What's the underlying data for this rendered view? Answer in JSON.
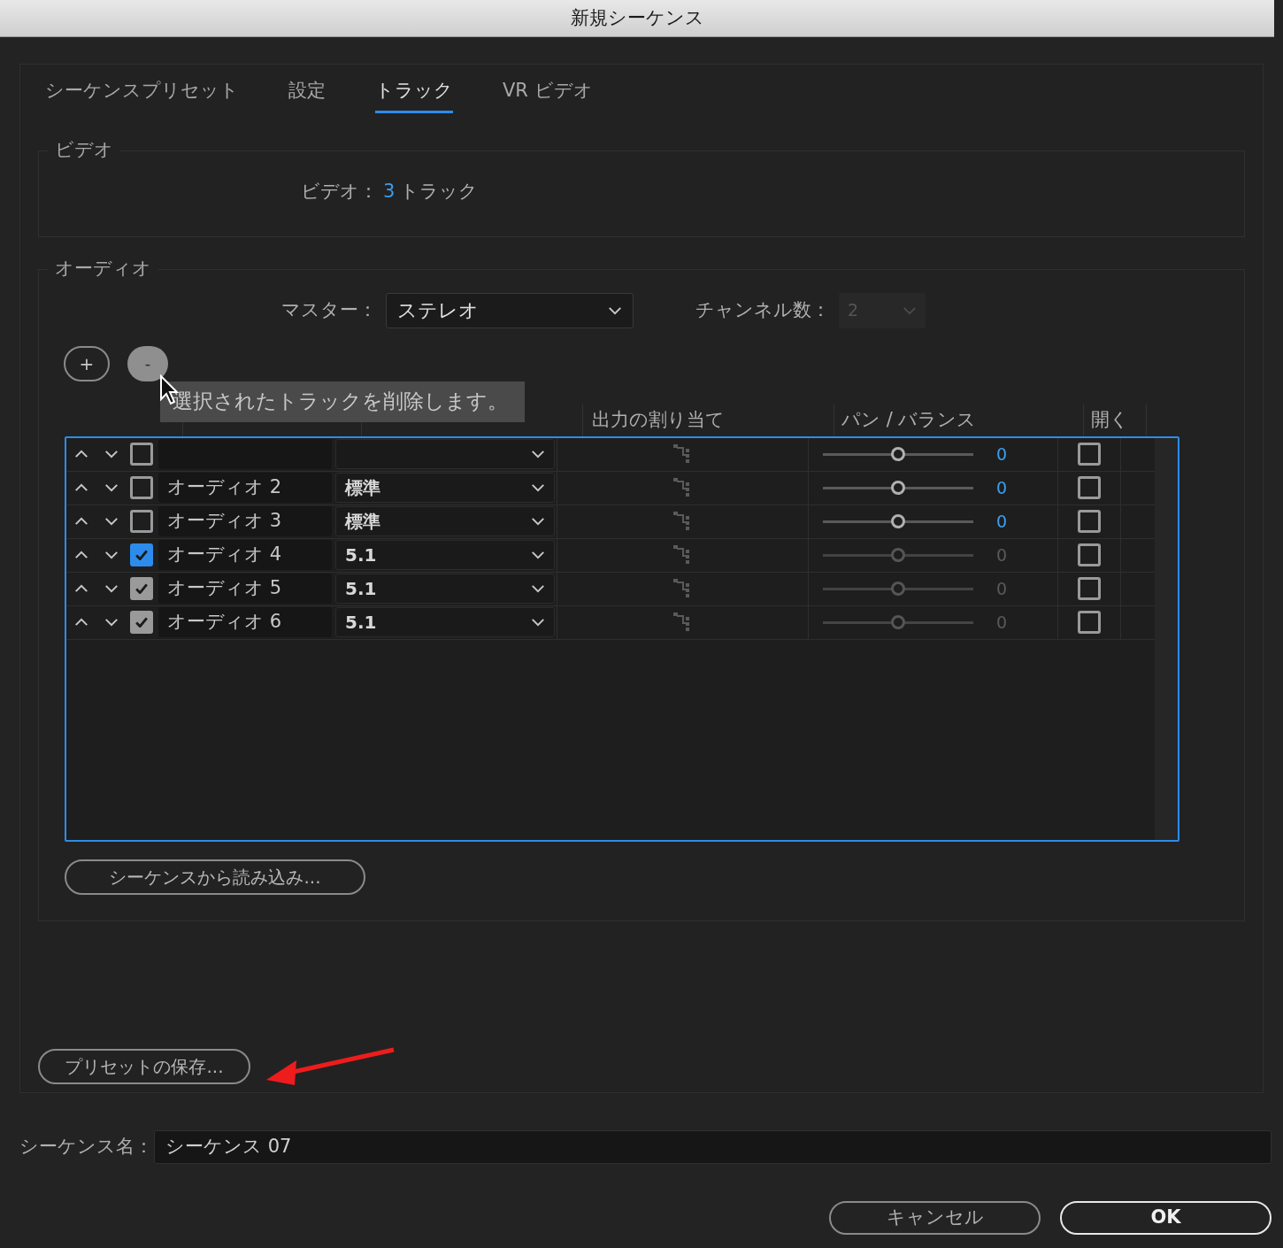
{
  "window": {
    "title": "新規シーケンス"
  },
  "tabs": [
    {
      "label": "シーケンスプリセット",
      "selected": false
    },
    {
      "label": "設定",
      "selected": false
    },
    {
      "label": "トラック",
      "selected": true
    },
    {
      "label": "VR ビデオ",
      "selected": false
    }
  ],
  "video": {
    "legend": "ビデオ",
    "label": "ビデオ：",
    "count": "3",
    "unit": "トラック"
  },
  "audio": {
    "legend": "オーディオ",
    "master_label": "マスター：",
    "master_value": "ステレオ",
    "channels_label": "チャンネル数：",
    "channels_value": "2",
    "channels_disabled": true,
    "add_button": "+",
    "remove_button": {
      "label": "-",
      "hovered": true
    },
    "tooltip": "選択されたトラックを削除します。",
    "columns": [
      {
        "label": "出力の割り当て"
      },
      {
        "label": "パン / バランス"
      },
      {
        "label": "開く"
      }
    ],
    "rows": [
      {
        "checked": false,
        "color": "#9a9a9a",
        "level": 0.5,
        "pan_value": "0",
        "pan_disabled": false,
        "open": false
      },
      {
        "name": "オーディオ 2",
        "type": "標準",
        "checked": false,
        "color": "#9a9a9a",
        "level": 0.5,
        "pan_value": "0",
        "pan_disabled": false,
        "open": false
      },
      {
        "name": "オーディオ 3",
        "type": "標準",
        "checked": false,
        "color": "#9a9a9a",
        "level": 0.5,
        "pan_value": "0",
        "pan_disabled": false,
        "open": false
      },
      {
        "name": "オーディオ 4",
        "type": "5.1",
        "checked": true,
        "color": "#2d8ceb",
        "level": 0.5,
        "pan_value": "0",
        "pan_disabled": true,
        "open": false
      },
      {
        "name": "オーディオ 5",
        "type": "5.1",
        "checked": true,
        "color": "#9a9a9a",
        "level": 0.5,
        "pan_value": "0",
        "pan_disabled": true,
        "open": false
      },
      {
        "name": "オーディオ 6",
        "type": "5.1",
        "checked": true,
        "color": "#9a9a9a",
        "level": 0.5,
        "pan_value": "0",
        "pan_disabled": true,
        "open": false
      }
    ],
    "import_button": "シーケンスから読み込み..."
  },
  "save_preset_button": "プリセットの保存...",
  "annotation": {
    "kind": "arrow"
  },
  "sequence_name": {
    "label": "シーケンス名：",
    "value": "シーケンス 07"
  },
  "buttons": [
    {
      "label": "キャンセル",
      "default": false
    },
    {
      "label": "OK",
      "default": true
    }
  ]
}
